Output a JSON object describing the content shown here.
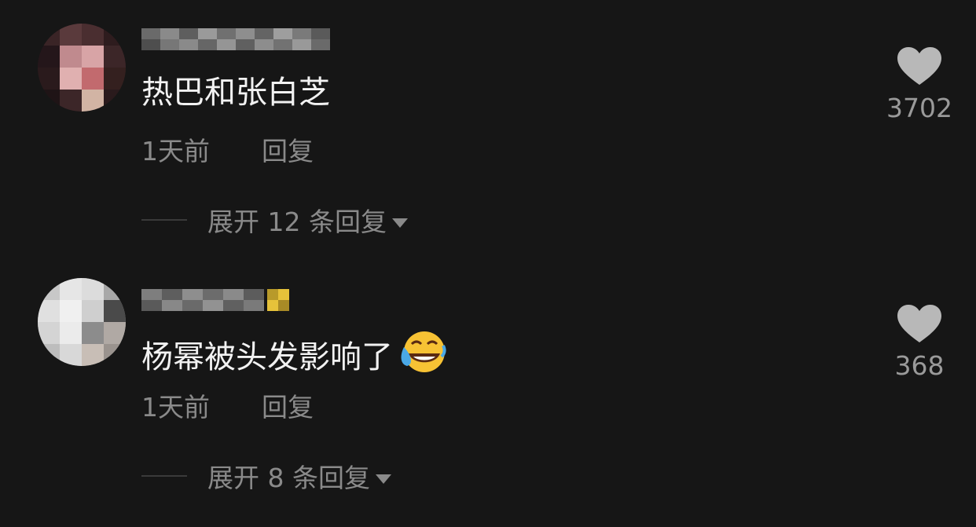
{
  "comments": [
    {
      "text": "热巴和张白芝",
      "time": "1天前",
      "reply_label": "回复",
      "expand_label": "展开 12 条回复",
      "likes": "3702"
    },
    {
      "text": "杨幂被头发影响了",
      "emoji": "laughing-crying-emoji",
      "time": "1天前",
      "reply_label": "回复",
      "expand_label": "展开 8 条回复",
      "likes": "368"
    }
  ],
  "colors": {
    "background": "#161616",
    "primary_text": "#f2f2f2",
    "secondary_text": "#8a8a8a",
    "heart": "#b8b8b8"
  }
}
